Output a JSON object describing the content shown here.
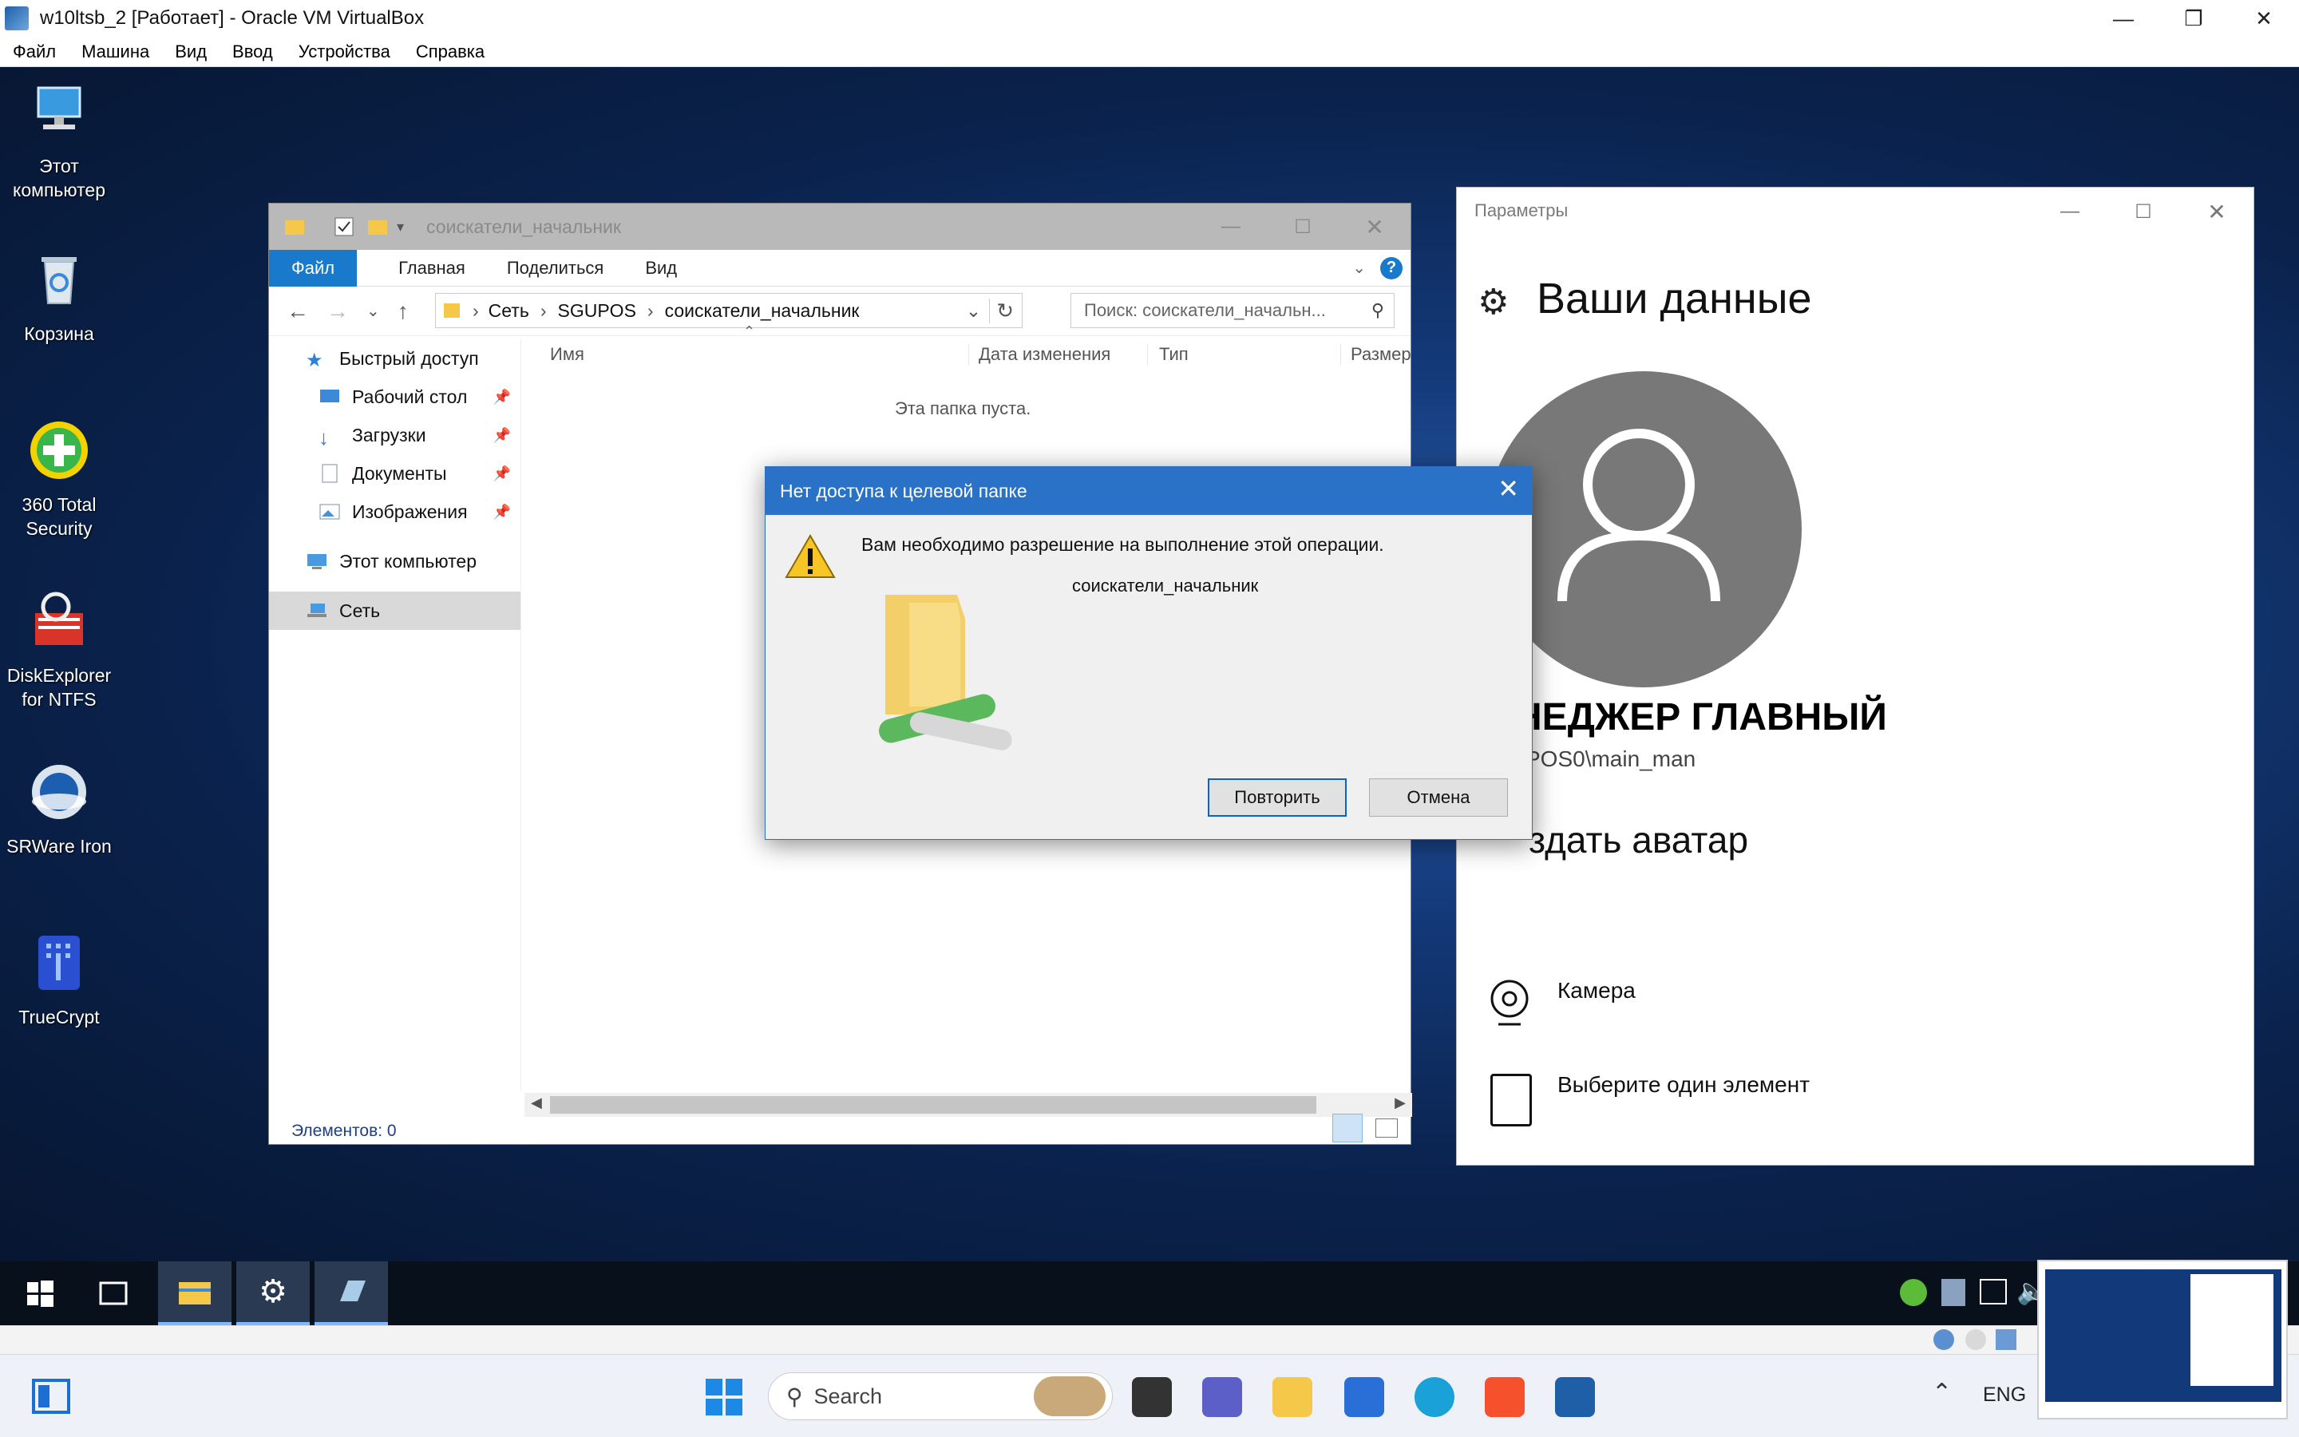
{
  "host_window": {
    "title": "w10ltsb_2 [Работает] - Oracle VM VirtualBox",
    "menu": [
      "Файл",
      "Машина",
      "Вид",
      "Ввод",
      "Устройства",
      "Справка"
    ]
  },
  "desktop_icons": [
    {
      "label": "Этот компьютер",
      "icon": "computer-icon"
    },
    {
      "label": "Корзина",
      "icon": "recycle-bin-icon"
    },
    {
      "label": "360 Total Security",
      "icon": "360-security-icon"
    },
    {
      "label": "DiskExplorer for NTFS",
      "icon": "disk-explorer-icon"
    },
    {
      "label": "SRWare Iron",
      "icon": "srware-iron-icon"
    },
    {
      "label": "TrueCrypt",
      "icon": "truecrypt-icon"
    }
  ],
  "explorer": {
    "title": "соискатели_начальник",
    "ribbon_tabs": [
      "Файл",
      "Главная",
      "Поделиться",
      "Вид"
    ],
    "breadcrumb": [
      "Сеть",
      "SGUPOS",
      "соискатели_начальник"
    ],
    "search_placeholder": "Поиск: соискатели_начальн...",
    "nav": {
      "quick_access": "Быстрый доступ",
      "items": [
        "Рабочий стол",
        "Загрузки",
        "Документы",
        "Изображения"
      ],
      "this_pc": "Этот компьютер",
      "network": "Сеть"
    },
    "columns": [
      "Имя",
      "Дата изменения",
      "Тип",
      "Размер"
    ],
    "empty_message": "Эта папка пуста.",
    "status": "Элементов: 0"
  },
  "dialog": {
    "title": "Нет доступа к целевой папке",
    "message": "Вам необходимо разрешение на выполнение этой операции.",
    "folder_name": "соискатели_начальник",
    "retry_label": "Повторить",
    "cancel_label": "Отмена"
  },
  "settings": {
    "window_title": "Параметры",
    "heading": "Ваши данные",
    "user_name_visible": "ЕНЕДЖЕР ГЛАВНЫЙ",
    "account_visible": "POS0\\main_man",
    "create_avatar_visible": "здать аватар",
    "options": [
      "Камера",
      "Выберите один элемент"
    ]
  },
  "host_taskbar": {
    "search_placeholder": "Search",
    "language": "ENG"
  },
  "colors": {
    "accent_blue": "#1979ca",
    "dialog_title": "#2a72c8",
    "avatar_gray": "#787878"
  }
}
